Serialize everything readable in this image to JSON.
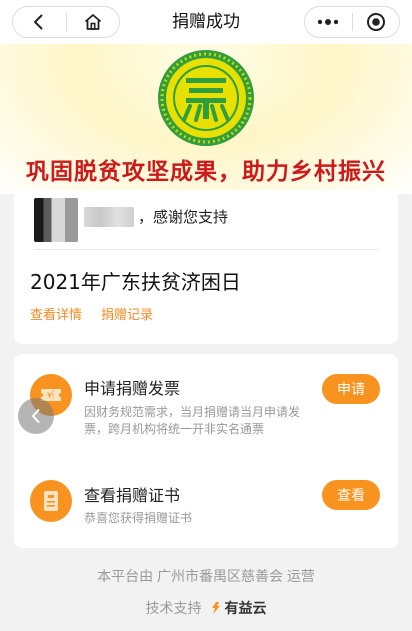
{
  "nav": {
    "title": "捐赠成功",
    "back_icon": "chevron-left-icon",
    "home_icon": "home-icon",
    "more_icon": "more-dots-icon",
    "close_icon": "target-close-icon"
  },
  "banner": {
    "slogan": "巩固脱贫攻坚成果，助力乡村振兴",
    "logo_icon": "charity-federation-logo"
  },
  "donor": {
    "thanks": "，感谢您支持"
  },
  "event": {
    "title": "2021年广东扶贫济困日",
    "link_detail": "查看详情",
    "link_records": "捐赠记录"
  },
  "invoice": {
    "icon": "ticket-icon",
    "title": "申请捐赠发票",
    "desc_line1": "因财务规范需求，当月捐赠请当月申请发",
    "desc_line2": "票，跨月机构将统一开非实名通票",
    "button": "申请"
  },
  "certificate": {
    "icon": "certificate-icon",
    "title": "查看捐赠证书",
    "desc": "恭喜您获得捐赠证书",
    "button": "查看"
  },
  "footer": {
    "operator": "本平台由 广州市番禺区慈善会 运营",
    "tech_label": "技术支持",
    "brand": "有益云"
  },
  "colors": {
    "accent": "#f7931e",
    "link": "#f08a24",
    "slogan": "#cc1a1a",
    "logo_green": "#2f9e3f",
    "logo_yellow": "#e8e000"
  }
}
